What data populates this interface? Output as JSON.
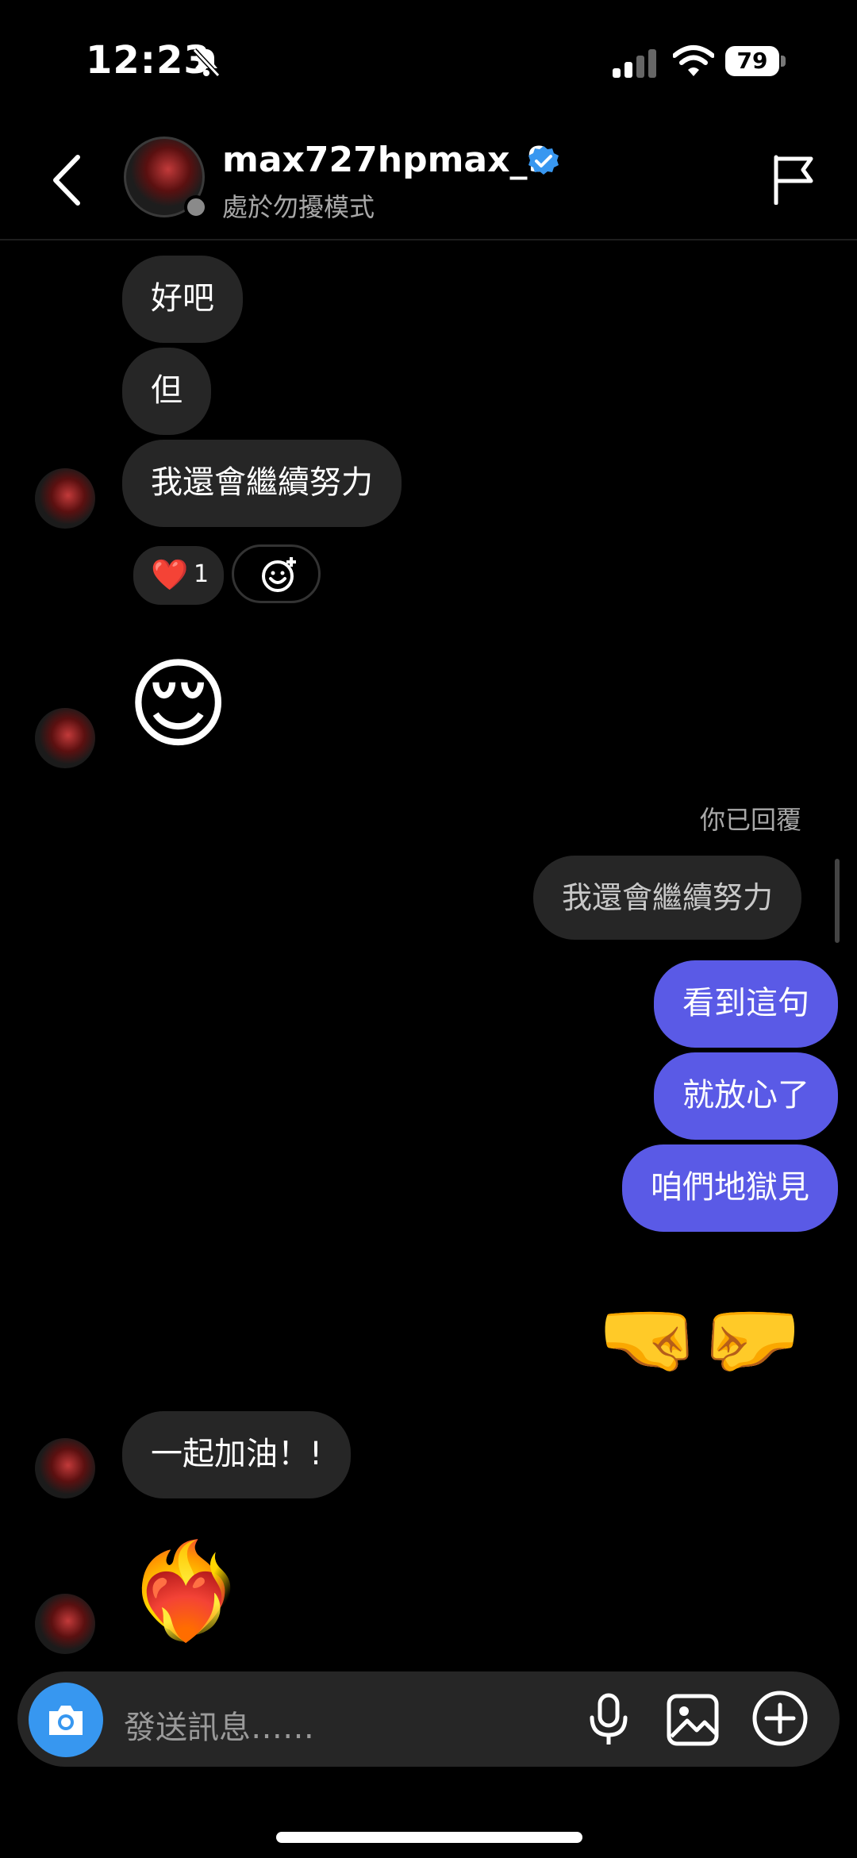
{
  "status_bar": {
    "time": "12:23",
    "battery": "79",
    "icons": [
      "bell-slash-icon",
      "cellular-signal-icon",
      "wifi-icon",
      "battery-icon"
    ]
  },
  "header": {
    "username": "max727hpmax_9",
    "status": "處於勿擾模式",
    "icons": [
      "back-chevron-icon",
      "verified-badge-icon",
      "flag-icon"
    ],
    "accent_verified": "#3897f0"
  },
  "messages": {
    "m1": "好吧",
    "m2": "但",
    "m3": "我還會繼續努力",
    "reaction": {
      "emoji": "❤️",
      "count": "1"
    },
    "emoji_relieved": "😌",
    "reply_label": "你已回覆",
    "quoted": "我還會繼續努力",
    "o1": "看到這句",
    "o2": "就放心了",
    "o3": "咱們地獄見",
    "fist_left": "🤜",
    "fist_right": "🤛",
    "m4": "一起加油！!",
    "emoji_fire_heart": "❤️‍🔥"
  },
  "composer": {
    "placeholder": "發送訊息……",
    "icons": [
      "camera-icon",
      "microphone-icon",
      "image-icon",
      "plus-circle-icon"
    ],
    "accent": "#3797f0"
  },
  "colors": {
    "outgoing_bubble": "#5a5ae6",
    "incoming_bubble": "#262626",
    "background": "#000000"
  }
}
